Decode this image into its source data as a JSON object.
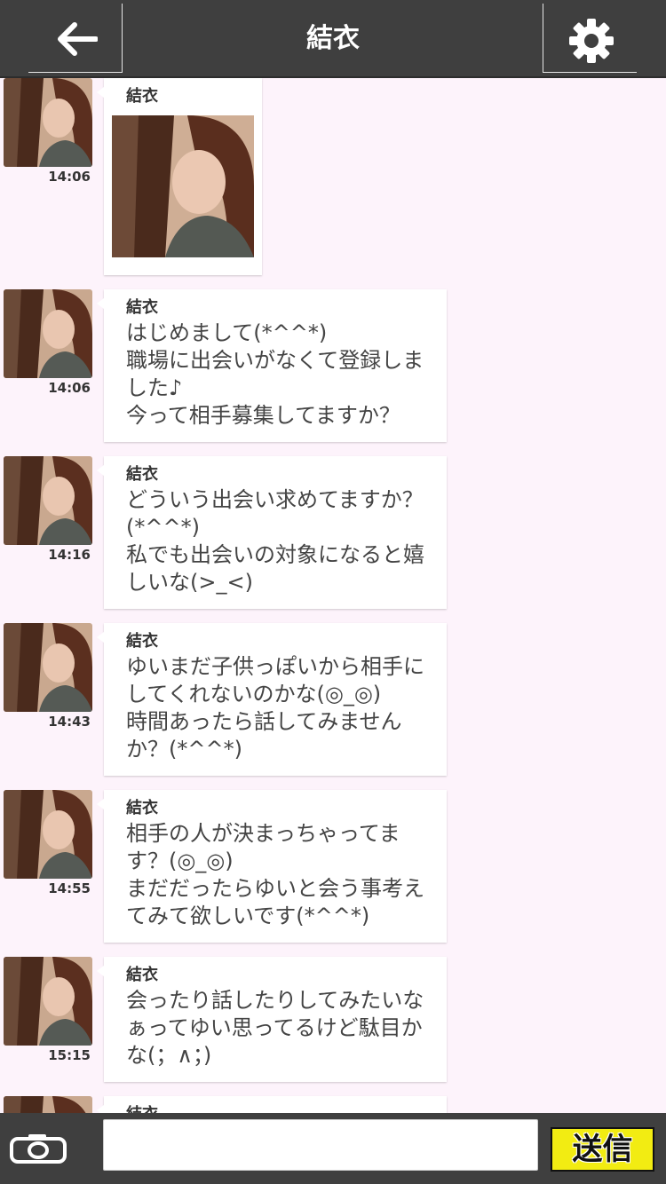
{
  "header": {
    "title": "結衣"
  },
  "messages": [
    {
      "sender": "結衣",
      "time": "14:06",
      "type": "image",
      "text": ""
    },
    {
      "sender": "結衣",
      "time": "14:06",
      "type": "text",
      "text": "はじめまして(*^^*)\n職場に出会いがなくて登録しま\nした♪\n今って相手募集してますか？"
    },
    {
      "sender": "結衣",
      "time": "14:16",
      "type": "text",
      "text": "どういう出会い求めてますか？\n(*^^*)\n私でも出会いの対象になると嬉\nしいな(>_<)"
    },
    {
      "sender": "結衣",
      "time": "14:43",
      "type": "text",
      "text": "ゆいまだ子供っぽいから相手に\nしてくれないのかな(◎_◎)\n時間あったら話してみません\nか？(*^^*)"
    },
    {
      "sender": "結衣",
      "time": "14:55",
      "type": "text",
      "text": "相手の人が決まっちゃってま\nす？(◎_◎)\nまだだったらゆいと会う事考え\nてみて欲しいです(*^^*)"
    },
    {
      "sender": "結衣",
      "time": "15:15",
      "type": "text",
      "text": "会ったり話したりしてみたいな\nぁってゆい思ってるけど駄目か\nな(；∧；)"
    },
    {
      "sender": "結衣",
      "time": "",
      "type": "text",
      "text": ""
    }
  ],
  "composer": {
    "value": "",
    "send_label": "送信"
  },
  "colors": {
    "header_bg": "#3f3f3f",
    "chat_bg": "#fdf3fb",
    "send_button": "#f2ec12"
  }
}
